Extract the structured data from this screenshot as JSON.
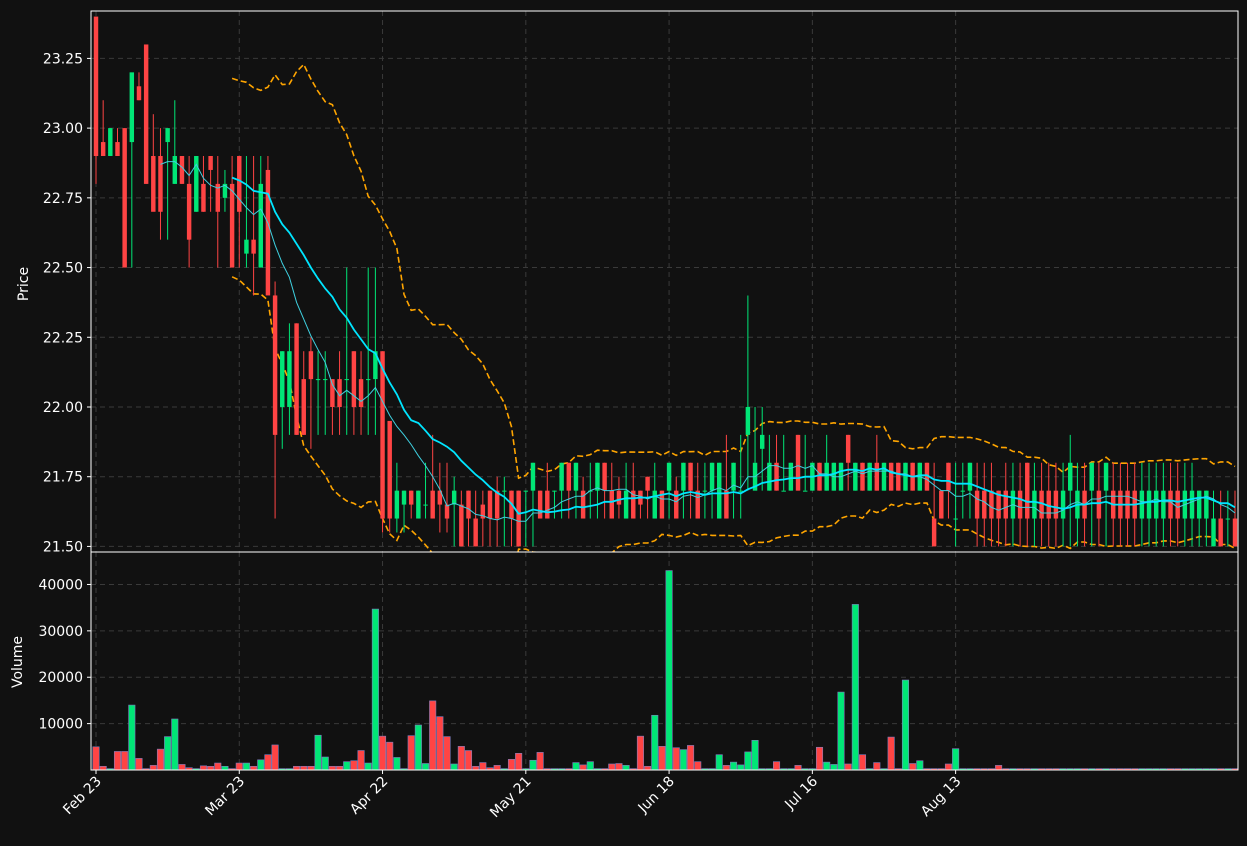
{
  "colors": {
    "background": "#111111",
    "frame": "#ffffff",
    "grid": "#3a3a3a",
    "up": "#00e676",
    "down": "#ff4444",
    "ma_fast": "#3fd0e0",
    "ma_slow": "#00e5ff",
    "band": "#ffa500",
    "volume_edge": "#7f7fbf"
  },
  "chart_data": {
    "type": "candlestick",
    "price_panel": {
      "ylabel": "Price",
      "ylim": [
        21.48,
        23.42
      ],
      "yticks": [
        "21.50",
        "21.75",
        "22.00",
        "22.25",
        "22.50",
        "22.75",
        "23.00",
        "23.25"
      ],
      "grid": true
    },
    "volume_panel": {
      "ylabel": "Volume",
      "ylim": [
        0,
        47000
      ],
      "yticks": [
        "10000",
        "20000",
        "30000",
        "40000"
      ],
      "grid": true
    },
    "x_ticks": [
      "Feb 23",
      "Mar 23",
      "Apr 22",
      "May 21",
      "Jun 18",
      "Jul 16",
      "Aug 13"
    ],
    "x_tick_index": [
      0,
      20,
      40,
      60,
      80,
      100,
      120
    ],
    "series": [
      {
        "kind": "ohlc",
        "open": [
          23.4,
          22.95,
          22.9,
          22.95,
          23.0,
          22.95,
          23.15,
          23.3,
          22.9,
          22.9,
          22.95,
          22.8,
          22.9,
          22.8,
          22.7,
          22.8,
          22.9,
          22.8,
          22.75,
          22.8,
          22.9,
          22.55,
          22.6,
          22.5,
          22.85,
          22.4,
          22.0,
          22.0,
          22.3,
          22.1,
          22.2,
          22.1,
          22.1,
          22.1,
          22.1,
          22.1,
          22.2,
          22.1,
          22.1,
          22.1,
          22.2,
          21.95,
          21.6,
          21.65,
          21.7,
          21.6,
          21.65,
          21.7,
          21.7,
          21.65,
          21.65,
          21.65,
          21.7,
          21.6,
          21.65,
          21.7,
          21.7,
          21.7,
          21.7,
          21.7,
          21.7
        ],
        "high": [
          23.4,
          23.1,
          23.0,
          23.0,
          23.0,
          23.05,
          23.2,
          23.3,
          23.05,
          23.0,
          22.95,
          23.1,
          22.9,
          22.9,
          22.9,
          22.9,
          22.9,
          22.9,
          22.85,
          22.9,
          22.9,
          22.9,
          22.9,
          22.9,
          22.9,
          22.45,
          22.2,
          22.3,
          22.3,
          22.2,
          22.25,
          22.2,
          22.2,
          22.1,
          22.2,
          22.5,
          22.2,
          22.2,
          22.5,
          22.5,
          22.2,
          21.8,
          21.8,
          21.7,
          21.7,
          21.7,
          21.8,
          21.9,
          21.8,
          21.8,
          21.75,
          21.7,
          21.7,
          21.7,
          21.7,
          21.7,
          21.75,
          21.75,
          21.7,
          21.7,
          21.7
        ],
        "low": [
          22.8,
          22.9,
          22.9,
          22.9,
          22.9,
          22.5,
          23.1,
          22.8,
          22.8,
          22.6,
          22.6,
          22.8,
          22.8,
          22.5,
          22.7,
          22.7,
          22.7,
          22.5,
          22.7,
          22.5,
          22.5,
          22.5,
          22.4,
          22.5,
          22.5,
          21.6,
          21.85,
          21.9,
          21.9,
          21.9,
          21.85,
          21.9,
          21.9,
          21.9,
          21.9,
          21.9,
          21.9,
          21.9,
          21.9,
          21.9,
          21.55,
          21.55,
          21.55,
          21.55,
          21.6,
          21.6,
          21.6,
          21.6,
          21.55,
          21.55,
          21.5,
          21.5,
          21.5,
          21.5,
          21.5,
          21.5,
          21.5,
          21.5,
          21.5,
          21.5,
          21.5
        ],
        "close": [
          22.9,
          22.9,
          23.0,
          22.9,
          22.5,
          23.2,
          23.1,
          22.8,
          22.7,
          22.7,
          23.0,
          22.9,
          22.8,
          22.6,
          22.9,
          22.7,
          22.85,
          22.7,
          22.8,
          22.5,
          22.7,
          22.6,
          22.55,
          22.8,
          22.4,
          21.9,
          22.2,
          22.2,
          21.9,
          21.9,
          22.1,
          22.1,
          22.1,
          22.0,
          22.0,
          22.1,
          22.0,
          22.0,
          22.1,
          22.2,
          21.6,
          21.6,
          21.7,
          21.7,
          21.65,
          21.7,
          21.65,
          21.6,
          21.65,
          21.6,
          21.7,
          21.5,
          21.6,
          21.5,
          21.6,
          21.6,
          21.6,
          21.7,
          21.6,
          21.5,
          21.7
        ],
        "volume": [
          5000,
          800,
          300,
          4000,
          4000,
          14000,
          2500,
          300,
          1000,
          4500,
          7200,
          11000,
          1200,
          500,
          300,
          900,
          800,
          1500,
          800,
          300,
          1500,
          1500,
          800,
          2200,
          3300,
          5400,
          300,
          300,
          800,
          800,
          800,
          7500,
          2800,
          800,
          800,
          1800,
          2000,
          4200,
          1500,
          34700,
          7300,
          6000,
          2700,
          300,
          7400,
          9700,
          1400,
          14900,
          11500,
          7200,
          1300,
          5100,
          4200,
          800,
          1600,
          500,
          1000,
          300,
          2300,
          3600,
          300
        ]
      }
    ],
    "more_ohlc": {
      "open": [
        21.7,
        21.7,
        21.7,
        21.7,
        21.7,
        21.8,
        21.7,
        21.7,
        21.7,
        21.7,
        21.8,
        21.7,
        21.7,
        21.6,
        21.7,
        21.7,
        21.75,
        21.6,
        21.7,
        21.7,
        21.7,
        21.7,
        21.8,
        21.7,
        21.7,
        21.7,
        21.6,
        21.7,
        21.7,
        21.7,
        21.9,
        21.7,
        21.85,
        21.7,
        21.8,
        21.7,
        21.7,
        21.9,
        21.7,
        21.7,
        21.8,
        21.7,
        21.7,
        21.7,
        21.9,
        21.7,
        21.8,
        21.7,
        21.8,
        21.7,
        21.8,
        21.8,
        21.7,
        21.8,
        21.7,
        21.8,
        21.6,
        21.7,
        21.8,
        21.6,
        21.7,
        21.7
      ],
      "high": [
        21.8,
        21.7,
        21.8,
        21.7,
        21.8,
        21.8,
        21.8,
        21.75,
        21.8,
        21.8,
        21.8,
        21.8,
        21.75,
        21.8,
        21.8,
        21.7,
        21.75,
        21.8,
        21.7,
        21.8,
        21.75,
        21.8,
        21.8,
        21.8,
        21.8,
        21.8,
        21.8,
        21.9,
        21.8,
        21.9,
        22.4,
        22.0,
        22.0,
        21.9,
        21.9,
        21.9,
        21.8,
        21.9,
        21.9,
        21.8,
        21.8,
        21.9,
        21.8,
        21.8,
        21.9,
        21.8,
        21.8,
        21.8,
        21.9,
        21.8,
        21.8,
        21.8,
        21.8,
        21.8,
        21.8,
        21.8,
        21.8,
        21.7,
        21.8,
        21.8,
        21.8,
        21.8
      ],
      "low": [
        21.5,
        21.6,
        21.6,
        21.6,
        21.6,
        21.6,
        21.6,
        21.6,
        21.6,
        21.6,
        21.6,
        21.6,
        21.6,
        21.6,
        21.6,
        21.6,
        21.6,
        21.6,
        21.6,
        21.6,
        21.6,
        21.6,
        21.6,
        21.6,
        21.6,
        21.6,
        21.6,
        21.6,
        21.6,
        21.6,
        21.7,
        21.8,
        21.7,
        21.7,
        21.7,
        21.7,
        21.7,
        21.7,
        21.7,
        21.7,
        21.7,
        21.7,
        21.7,
        21.7,
        21.7,
        21.7,
        21.7,
        21.7,
        21.7,
        21.7,
        21.7,
        21.7,
        21.7,
        21.7,
        21.7,
        21.7,
        21.5,
        21.6,
        21.6,
        21.5,
        21.6,
        21.6
      ],
      "close": [
        21.8,
        21.6,
        21.6,
        21.7,
        21.8,
        21.7,
        21.8,
        21.6,
        21.7,
        21.8,
        21.7,
        21.6,
        21.65,
        21.7,
        21.6,
        21.65,
        21.7,
        21.7,
        21.6,
        21.8,
        21.6,
        21.8,
        21.7,
        21.6,
        21.7,
        21.8,
        21.8,
        21.6,
        21.8,
        21.7,
        22.0,
        21.8,
        21.9,
        21.8,
        21.7,
        21.7,
        21.8,
        21.7,
        21.7,
        21.8,
        21.7,
        21.8,
        21.8,
        21.8,
        21.8,
        21.8,
        21.7,
        21.8,
        21.7,
        21.8,
        21.7,
        21.7,
        21.8,
        21.7,
        21.8,
        21.7,
        21.5,
        21.6,
        21.7,
        21.6,
        21.7,
        21.8
      ],
      "volume": [
        2100,
        3800,
        300,
        300,
        300,
        300,
        1600,
        1100,
        1800,
        300,
        300,
        1300,
        1400,
        1000,
        300,
        7300,
        800,
        11800,
        5100,
        43000,
        4800,
        4400,
        5300,
        1800,
        300,
        300,
        3300,
        1000,
        1700,
        1100,
        3900,
        6400,
        300,
        300,
        1800,
        300,
        300,
        1000,
        300,
        300,
        4900,
        1700,
        1200,
        16800,
        1300,
        35700,
        3300,
        300,
        1600,
        300,
        7100,
        300,
        19400,
        1400,
        2000,
        300,
        300,
        300,
        1300,
        4600,
        300,
        300
      ]
    },
    "tail_ohlc": {
      "open": [
        21.7,
        21.7,
        21.7,
        21.7,
        21.7,
        21.6,
        21.7,
        21.8,
        21.6,
        21.7,
        21.7,
        21.7,
        21.6,
        21.7,
        21.6,
        21.7,
        21.7,
        21.7,
        21.7,
        21.7,
        21.7,
        21.7,
        21.7,
        21.6,
        21.6,
        21.6,
        21.6,
        21.7,
        21.7,
        21.6,
        21.6,
        21.6,
        21.6,
        21.5,
        21.6,
        21.6,
        21.6
      ],
      "high": [
        21.8,
        21.8,
        21.8,
        21.7,
        21.8,
        21.8,
        21.8,
        21.8,
        21.8,
        21.8,
        21.8,
        21.8,
        21.8,
        21.9,
        21.8,
        21.8,
        21.8,
        21.8,
        21.8,
        21.8,
        21.8,
        21.8,
        21.8,
        21.8,
        21.8,
        21.8,
        21.8,
        21.8,
        21.8,
        21.8,
        21.8,
        21.7,
        21.7,
        21.7,
        21.7,
        21.7,
        21.7
      ],
      "low": [
        21.5,
        21.5,
        21.5,
        21.5,
        21.5,
        21.5,
        21.5,
        21.5,
        21.5,
        21.5,
        21.5,
        21.5,
        21.5,
        21.5,
        21.5,
        21.5,
        21.5,
        21.5,
        21.5,
        21.5,
        21.5,
        21.5,
        21.5,
        21.5,
        21.5,
        21.5,
        21.5,
        21.5,
        21.5,
        21.5,
        21.5,
        21.5,
        21.5,
        21.5,
        21.5,
        21.5,
        21.5
      ],
      "close": [
        21.6,
        21.6,
        21.6,
        21.6,
        21.6,
        21.7,
        21.6,
        21.6,
        21.7,
        21.6,
        21.6,
        21.6,
        21.7,
        21.8,
        21.7,
        21.6,
        21.8,
        21.6,
        21.8,
        21.6,
        21.6,
        21.6,
        21.6,
        21.7,
        21.7,
        21.7,
        21.7,
        21.6,
        21.6,
        21.7,
        21.7,
        21.7,
        21.7,
        21.6,
        21.5,
        21.6,
        21.5
      ],
      "volume": [
        300,
        300,
        300,
        1000,
        300,
        300,
        300,
        300,
        300,
        300,
        300,
        300,
        300,
        300,
        300,
        300,
        300,
        300,
        300,
        300,
        300,
        300,
        300,
        300,
        300,
        300,
        300,
        300,
        300,
        300,
        300,
        300,
        300,
        300,
        300,
        300,
        300
      ]
    }
  }
}
